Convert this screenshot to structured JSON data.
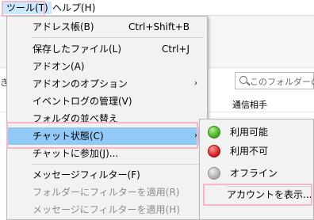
{
  "menubar": {
    "tools": "ツール(T)",
    "help": "ヘルプ(H)"
  },
  "background": {
    "left_edge_text": "き",
    "search_placeholder": "このフォルダーのメ",
    "column_header": "通信相手"
  },
  "tools_menu": {
    "items": [
      {
        "label": "アドレス帳(B)",
        "shortcut": "Ctrl+Shift+B"
      },
      {
        "label": "保存したファイル(L)",
        "shortcut": "Ctrl+J"
      },
      {
        "label": "アドオン(A)"
      },
      {
        "label": "アドオンのオプション",
        "submenu_arrow": "›"
      },
      {
        "label": "イベントログの管理(V)"
      },
      {
        "label": "フォルダの並べ替え"
      },
      {
        "label": "チャット状態(C)",
        "submenu_arrow": "›"
      },
      {
        "label": "チャットに参加(J)..."
      },
      {
        "label": "メッセージフィルター(F)"
      },
      {
        "label": "フォルダーにフィルターを適用(R)"
      },
      {
        "label": "メッセージにフィルターを適用(H)"
      }
    ]
  },
  "chat_submenu": {
    "items": [
      {
        "label": "利用可能",
        "icon": "green-status-dot"
      },
      {
        "label": "利用不可",
        "icon": "red-status-dot"
      },
      {
        "label": "オフライン",
        "icon": "gray-status-dot"
      },
      {
        "label": "アカウントを表示..."
      }
    ]
  },
  "colors": {
    "highlight_blue": "#91c9f7",
    "annotation_pink": "#f4b8cc"
  }
}
